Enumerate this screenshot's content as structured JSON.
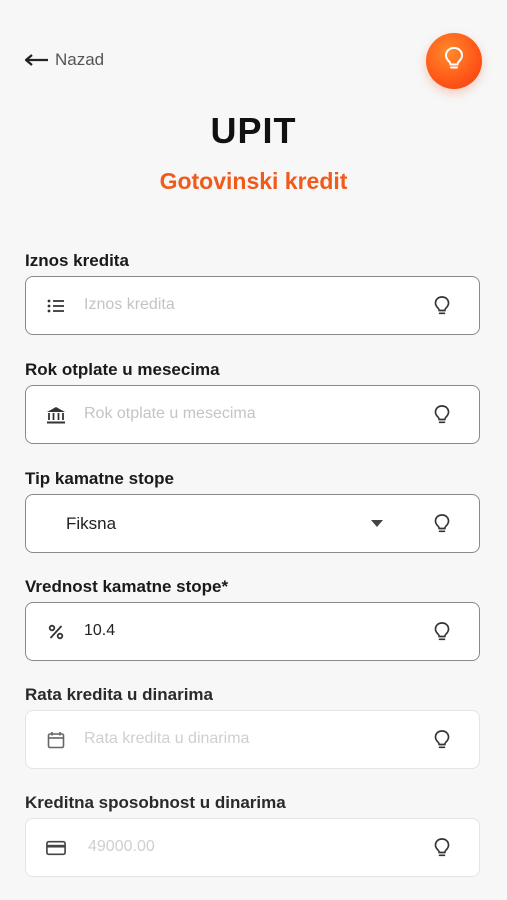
{
  "nav": {
    "back_label": "Nazad"
  },
  "header": {
    "title": "UPIT",
    "subtitle": "Gotovinski kredit"
  },
  "colors": {
    "accent": "#f05a1a",
    "border": "#8a8a8a",
    "placeholder": "#c4c4c4"
  },
  "fields": {
    "iznos": {
      "label": "Iznos kredita",
      "placeholder": "Iznos kredita",
      "value": "",
      "icon": "list-icon"
    },
    "rok": {
      "label": "Rok otplate u mesecima",
      "placeholder": "Rok otplate u mesecima",
      "value": "",
      "icon": "bank-icon"
    },
    "tip": {
      "label": "Tip kamatne stope",
      "selected": "Fiksna"
    },
    "vrednost": {
      "label": "Vrednost kamatne stope*",
      "value": "10.4",
      "icon": "percent-icon"
    },
    "rata": {
      "label": "Rata kredita u dinarima",
      "placeholder": "Rata kredita u dinarima",
      "value": "",
      "icon": "calendar-icon"
    },
    "sposobnost": {
      "label": "Kreditna sposobnost u dinarima",
      "placeholder": "49000.00",
      "value": "",
      "icon": "credit-card-icon"
    }
  }
}
